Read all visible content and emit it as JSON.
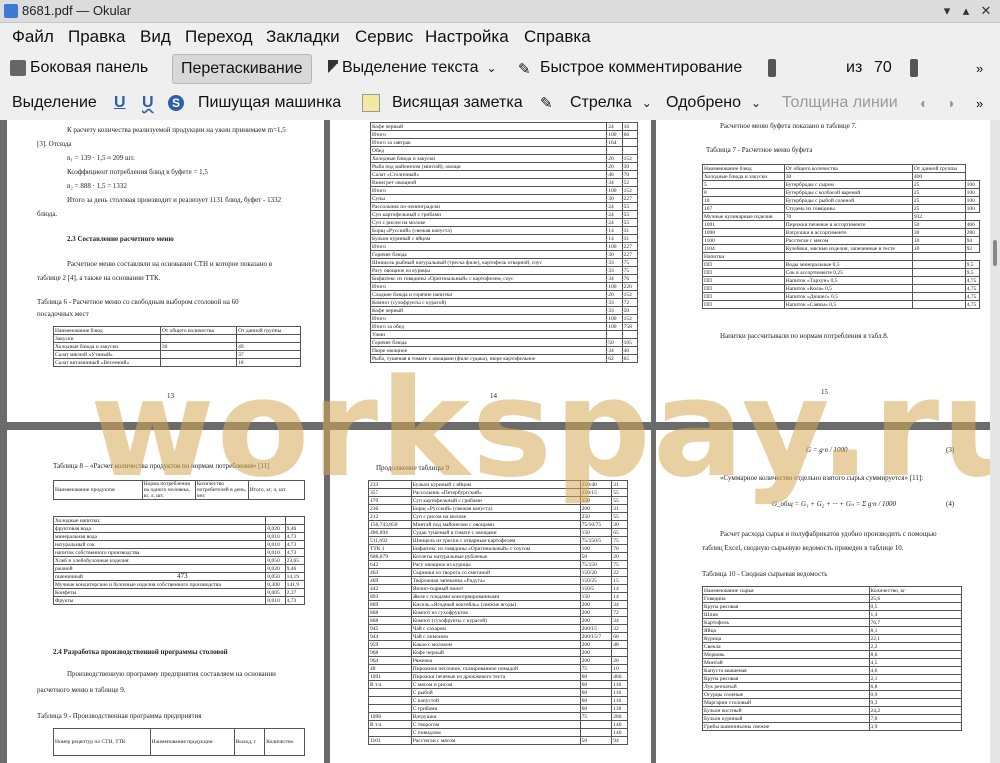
{
  "window": {
    "title": "8681.pdf — Okular"
  },
  "menu": [
    "Файл",
    "Правка",
    "Вид",
    "Переход",
    "Закладки",
    "Сервис",
    "Настройка",
    "Справка"
  ],
  "toolbar1": {
    "sidebar": "Боковая панель",
    "drag": "Перетаскивание",
    "text_select": "Выделение текста",
    "quick_comment": "Быстрое комментирование",
    "page_current": "17",
    "page_of": "из",
    "page_total": "70"
  },
  "toolbar2": {
    "highlight": "Выделение",
    "typewriter": "Пишущая машинка",
    "popup_note": "Висящая заметка",
    "arrow": "Стрелка",
    "approved": "Одобрено",
    "line_width": "Толщина линии"
  },
  "watermark": "workspay.ru",
  "pages": {
    "p13": {
      "lines": [
        "К расчету количества реализуемой продукции на ужин принимаем m=1,5",
        "[3]. Отсюда",
        "n₁ = 139 · 1,5 ≈ 209 шт.",
        "Коэффициент потребления блюд в буфете = 1,5",
        "n₂ = 888 · 1,5 = 1332",
        "Итого за день столовая производит и реализует 1131 блюд, буфет - 1332",
        "блюда.",
        "2.3 Составление расчетного меню",
        "Расчетное меню составляли на основании СТН и которое показано в",
        "таблице 2 [4], а также на основании ТТК.",
        "Таблица 6 - Расчетное меню со свободным выбором столовой на 60",
        "посадочных мест"
      ],
      "table": [
        [
          "Наименование блюд",
          "От общего количества",
          "От данной группы"
        ],
        [
          "Закуски",
          "",
          ""
        ],
        [
          "Холодные блюда и закуски",
          "30",
          "49"
        ],
        [
          "Салат мясной «Утиный»",
          "",
          "37"
        ],
        [
          "Салат витаминный «Весенний»",
          "",
          "18"
        ]
      ],
      "page_no": "13"
    },
    "p14": {
      "rows": [
        [
          "Кофе черный",
          "24",
          "16"
        ],
        [
          "Итого",
          "100",
          "66"
        ],
        [
          "Итого за завтрак",
          "164",
          ""
        ],
        [
          "Обед",
          "",
          ""
        ],
        [
          "Холодные блюда и закуски",
          "20",
          "152"
        ],
        [
          "Рыба под майонезом (минтай), овощи",
          "20",
          "30"
        ],
        [
          "Салат «Столичный»",
          "46",
          "70"
        ],
        [
          "Винегрет овощной",
          "34",
          "52"
        ],
        [
          "Итого",
          "100",
          "152"
        ],
        [
          "Супы",
          "30",
          "227"
        ],
        [
          "Рассольник по-ленинградски",
          "24",
          "55"
        ],
        [
          "Суп картофельный с грибами",
          "24",
          "55"
        ],
        [
          "Суп с рисом на молоке",
          "24",
          "55"
        ],
        [
          "Борщ «Русский» (свежая капуста)",
          "14",
          "31"
        ],
        [
          "Бульон куриный с яйцом",
          "14",
          "31"
        ],
        [
          "Итого",
          "100",
          "227"
        ],
        [
          "Горячие блюда",
          "30",
          "227"
        ],
        [
          "Шницель рыбный натуральный (треска филе), картофель отварной, соус",
          "33",
          "75"
        ],
        [
          "Рагу овощное из курицы",
          "33",
          "75"
        ],
        [
          "Бифштекс из говядины «Оригинальный» с картофелем, соус",
          "34",
          "76"
        ],
        [
          "Итого",
          "100",
          "226"
        ],
        [
          "Сладкие блюда и горячие напитки",
          "20",
          "152"
        ],
        [
          "Компот (сухофрукты с курагой)",
          "33",
          "72"
        ],
        [
          "Кофе черный",
          "33",
          "50"
        ],
        [
          "Итого",
          "100",
          "152"
        ],
        [
          "Итого за обед",
          "100",
          "758"
        ],
        [
          "Ужин",
          "",
          ""
        ],
        [
          "Горячие блюда",
          "50",
          "105"
        ],
        [
          "Пюре овощное",
          "34",
          "40"
        ],
        [
          "Рыба, тушеная в томате с овощами (филе судака), пюре картофельное",
          "62",
          "65"
        ]
      ],
      "page_no": "14"
    },
    "p15": {
      "lines": [
        "Расчетное меню буфета показано в таблице 7.",
        "Таблица 7 - Расчетное меню буфета",
        "Напитки рассчитывали по нормам потребления в табл.8."
      ],
      "rows": [
        [
          "Наименование блюд",
          "От общего количества",
          "От данной группы"
        ],
        [
          "Холодные блюда и закуски",
          "30",
          "400"
        ],
        [
          "5",
          "Бутерброды с сыром",
          "25",
          "100"
        ],
        [
          "8",
          "Бутерброды с колбасой вареной",
          "25",
          "100"
        ],
        [
          "10",
          "Бутерброды с рыбой соленой",
          "25",
          "100"
        ],
        [
          "167",
          "Студень из говядины",
          "25",
          "100"
        ],
        [
          "Мучные кулинарные изделия",
          "70",
          "932"
        ],
        [
          "1091",
          "Пирожки печеные в ассортименте",
          "50",
          "466"
        ],
        [
          "1098",
          "Ватрушки в ассортименте",
          "30",
          "280"
        ],
        [
          "1100",
          "Расстегаи с мясом",
          "10",
          "94"
        ],
        [
          "1104",
          "Кулебяки, мясные изделия, запеченные в тесте",
          "10",
          "92"
        ],
        [
          "Напитки",
          "",
          ""
        ],
        [
          "ПП",
          "Воды минеральные 0,5",
          "",
          "9,5"
        ],
        [
          "ПП",
          "Сок в ассортименте 0,25",
          "",
          "9,5"
        ],
        [
          "ПП",
          "Напиток «Тархун» 0,5",
          "",
          "4,75"
        ],
        [
          "ПП",
          "Напиток «Кола» 0,5",
          "",
          "4,75"
        ],
        [
          "ПП",
          "Напиток «Дюшес» 0,5",
          "",
          "4,75"
        ],
        [
          "ПП",
          "Напиток «Саяны» 0,5",
          "",
          "4,75"
        ]
      ],
      "page_no": "15"
    },
    "p16": {
      "lines": [
        "Таблица 8 – «Расчет количества продуктов по нормам потребления» [11]",
        "2.4 Разработка производственной программы столовой",
        "Производственную программу предприятия составляем на основании",
        "расчетного меню в таблице 9.",
        "Таблица 9 - Производственная программа предприятия"
      ],
      "head": [
        "Наименование продуктов",
        "Норма потребления на одного человека, кг, л, шт.",
        "Количество потребителей в день, чел",
        "Итого, кг, л, шт."
      ],
      "rows": [
        [
          "Холодные напитки:",
          "",
          ""
        ],
        [
          "фруктовая вода",
          "0,020",
          "9,46"
        ],
        [
          "минеральная вода",
          "0,010",
          "4,73"
        ],
        [
          "натуральный сок",
          "0,010",
          "4,73"
        ],
        [
          "напиток собственного производства",
          "0,010",
          "4,73"
        ],
        [
          "Хлеб и хлебобулочные изделия:",
          "0,050",
          "23,65"
        ],
        [
          "ржаной",
          "0,020",
          "9,46"
        ],
        [
          "пшеничный",
          "0,050",
          "14,19"
        ],
        [
          "Мучные кондитерские и булочные изделия собственного производства",
          "0,300",
          "141,9"
        ],
        [
          "Конфеты",
          "0,005",
          "2,37"
        ],
        [
          "Фрукты",
          "0,010",
          "4,73"
        ]
      ],
      "count": "473",
      "t9head": [
        "Номер рецептур по СТН, ТТК",
        "Наименование продукции",
        "Выход, г",
        "Количество"
      ]
    },
    "p17": {
      "lines": [
        "Продолжение таблицы 9"
      ],
      "head": [
        "1",
        "2",
        "3",
        "4"
      ],
      "rows": [
        [
          "233",
          "Бульон куриный с яйцом",
          "250/40",
          "31"
        ],
        [
          "357",
          "Рассольник «Петербургский»",
          "250/15",
          "55"
        ],
        [
          "170",
          "Суп картофельный с грибами",
          "250",
          "55"
        ],
        [
          "236",
          "Борщ «Русский» (свежая капуста)",
          "200",
          "31"
        ],
        [
          "212",
          "Суп с рисом на молоке",
          "250",
          "55"
        ],
        [
          "156,743,850",
          "Минтай под майонезом с овощами",
          "75/10/75",
          "30"
        ],
        [
          "486,694",
          "Судак тушеный в томате с овощами",
          "150",
          "65"
        ],
        [
          "511,692",
          "Шницель из трески с отварным картофелем",
          "75/150/5",
          "75"
        ],
        [
          "ТТК 1",
          "Бифштекс из говядины «Оригинальный» с соусом",
          "100",
          "76"
        ],
        [
          "608,679",
          "Котлеты натуральные рубленые",
          "50",
          "20"
        ],
        [
          "642",
          "Рагу овощное из курицы",
          "75/150",
          "75"
        ],
        [
          "463",
          "Сырники из творога со сметаной",
          "150/20",
          "22"
        ],
        [
          "469",
          "Творожная запеканка «Радуга»",
          "150/25",
          "15"
        ],
        [
          "442",
          "Яично-сырный омлет",
          "150/5",
          "14"
        ],
        [
          "893",
          "Желе с плодами консервированными",
          "150",
          "14"
        ],
        [
          "869",
          "Кисель «Ягодный коктейль» (свежие ягоды)",
          "200",
          "34"
        ],
        [
          "868",
          "Компот из сухофруктов",
          "200",
          "72"
        ],
        [
          "868",
          "Компот (сухофрукты с курагой)",
          "200",
          "34"
        ],
        [
          "945",
          "Чай с сахаром",
          "200/15",
          "32"
        ],
        [
          "944",
          "Чай с лимоном",
          "200/15/7",
          "66"
        ],
        [
          "959",
          "Какао с молоком",
          "200",
          "48"
        ],
        [
          "968",
          "Кофе черный",
          "200",
          ""
        ],
        [
          "964",
          "Ряженка",
          "200",
          "26"
        ],
        [
          "48",
          "Пирожное песочное, глазированное помадой",
          "75",
          "10"
        ],
        [
          "1091",
          "Пирожки печеные из дрожжевого теста",
          "60",
          "466"
        ],
        [
          "В т.ч.",
          "С мясом и рисом",
          "60",
          "116"
        ],
        [
          "",
          "С рыбой",
          "60",
          "116"
        ],
        [
          "",
          "С капустой",
          "60",
          "116"
        ],
        [
          "",
          "С грибами",
          "60",
          "118"
        ],
        [
          "1098",
          "Ватрушки",
          "75",
          "280"
        ],
        [
          "В т.ч.",
          "С творогом",
          "",
          "140"
        ],
        [
          "",
          "С повидлом",
          "",
          "140"
        ],
        [
          "1101",
          "Расстегаи с мясом",
          "50",
          "94"
        ]
      ]
    },
    "p18": {
      "lines": [
        "«Суммарное количество отдельно взятого сырья суммируется» [11]:",
        "Расчет расхода сырья и полуфабрикатов удобно производить с помощью",
        "таблиц Excel, сводную сырьевую ведомость приведен в таблице 10.",
        "Таблица 10 - Сводная сырьевая ведомость"
      ],
      "eq1": "G = g·n / 1000",
      "eq1no": "(3)",
      "eq2": "G_общ = G₁ + G₂ + ··· + Gₙ = Σ g·n / 1000",
      "eq2no": "(4)",
      "head": [
        "Наименование сырья",
        "Количество, кг"
      ],
      "rows": [
        [
          "Говядина",
          "25,6"
        ],
        [
          "Крупа рисовая",
          "0,5"
        ],
        [
          "Шпик",
          "1,4"
        ],
        [
          "Картофель",
          "76,7"
        ],
        [
          "Яйца",
          "8,1"
        ],
        [
          "Курица",
          "22,1"
        ],
        [
          "Свекла",
          "2,2"
        ],
        [
          "Морковь",
          "8,6"
        ],
        [
          "Минтай",
          "4,5"
        ],
        [
          "Капуста квашеная",
          "4,6"
        ],
        [
          "Крупа рисовая",
          "2,1"
        ],
        [
          "Лук репчатый",
          "6,8"
        ],
        [
          "Огурцы соленые",
          "0,9"
        ],
        [
          "Маргарин столовый",
          "9,3"
        ],
        [
          "Бульон костный",
          "24,2"
        ],
        [
          "Бульон куриный",
          "7,8"
        ],
        [
          "Грибы шампиньоны свежие",
          "3,9"
        ]
      ]
    }
  }
}
